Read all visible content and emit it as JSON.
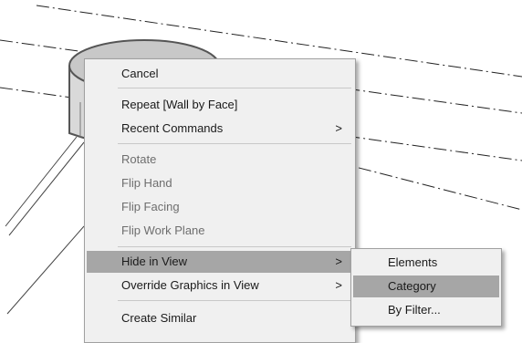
{
  "context_menu": {
    "items": [
      {
        "label": "Cancel"
      },
      {
        "label": "Repeat [Wall by Face]"
      },
      {
        "label": "Recent Commands"
      },
      {
        "label": "Rotate"
      },
      {
        "label": "Flip Hand"
      },
      {
        "label": "Flip Facing"
      },
      {
        "label": "Flip Work Plane"
      },
      {
        "label": "Hide in View"
      },
      {
        "label": "Override Graphics in View"
      },
      {
        "label": "Create Similar"
      }
    ],
    "submenu_arrow": ">"
  },
  "submenu": {
    "items": [
      {
        "label": "Elements"
      },
      {
        "label": "Category"
      },
      {
        "label": "By Filter..."
      }
    ]
  },
  "colors": {
    "menu_bg": "#f0f0f0",
    "highlight": "#a6a6a6",
    "disabled_text": "#6e6e6e"
  }
}
